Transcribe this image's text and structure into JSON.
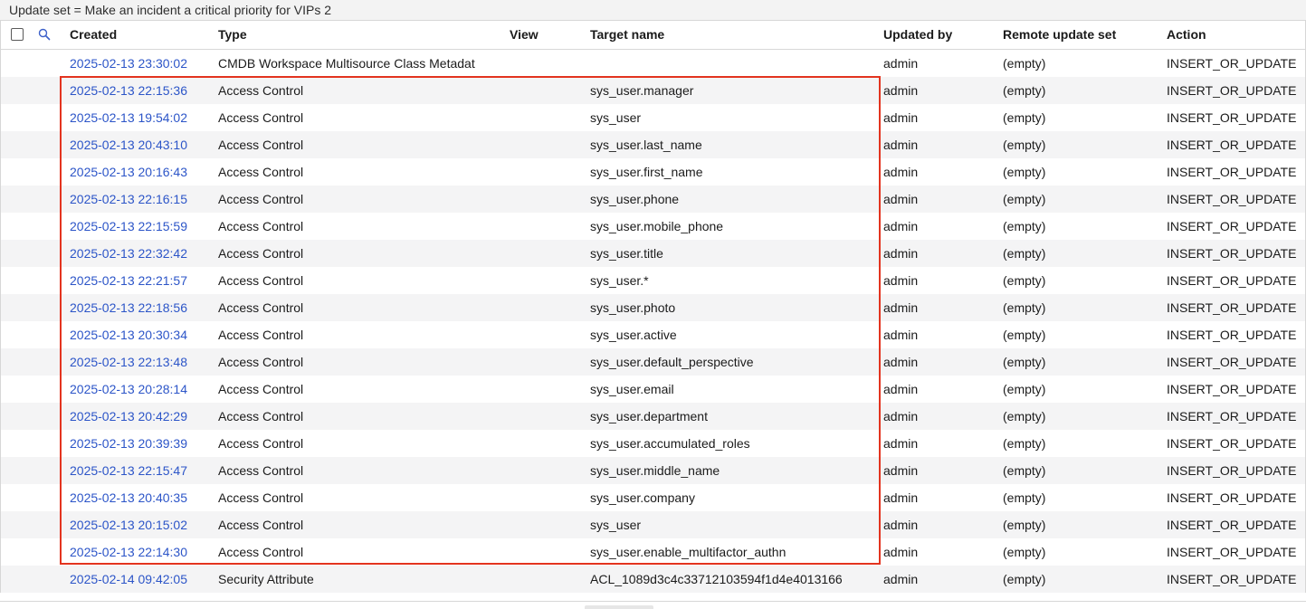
{
  "title_bar": "Update set = Make an incident a critical priority for VIPs 2",
  "columns": {
    "created": "Created",
    "type": "Type",
    "view": "View",
    "target_name": "Target name",
    "updated_by": "Updated by",
    "remote_update_set": "Remote update set",
    "action": "Action"
  },
  "icons": {
    "select_all": "checkbox-icon",
    "search": "search-icon"
  },
  "colors": {
    "link": "#2c55c8",
    "highlight_border": "#e3341f",
    "row_alt": "#f4f4f5"
  },
  "rows": [
    {
      "created": "2025-02-13 23:30:02",
      "type": "CMDB Workspace Multisource Class Metadat",
      "view": "",
      "target": "",
      "updated_by": "admin",
      "remote": "(empty)",
      "action": "INSERT_OR_UPDATE"
    },
    {
      "created": "2025-02-13 22:15:36",
      "type": "Access Control",
      "view": "",
      "target": "sys_user.manager",
      "updated_by": "admin",
      "remote": "(empty)",
      "action": "INSERT_OR_UPDATE"
    },
    {
      "created": "2025-02-13 19:54:02",
      "type": "Access Control",
      "view": "",
      "target": "sys_user",
      "updated_by": "admin",
      "remote": "(empty)",
      "action": "INSERT_OR_UPDATE"
    },
    {
      "created": "2025-02-13 20:43:10",
      "type": "Access Control",
      "view": "",
      "target": "sys_user.last_name",
      "updated_by": "admin",
      "remote": "(empty)",
      "action": "INSERT_OR_UPDATE"
    },
    {
      "created": "2025-02-13 20:16:43",
      "type": "Access Control",
      "view": "",
      "target": "sys_user.first_name",
      "updated_by": "admin",
      "remote": "(empty)",
      "action": "INSERT_OR_UPDATE"
    },
    {
      "created": "2025-02-13 22:16:15",
      "type": "Access Control",
      "view": "",
      "target": "sys_user.phone",
      "updated_by": "admin",
      "remote": "(empty)",
      "action": "INSERT_OR_UPDATE"
    },
    {
      "created": "2025-02-13 22:15:59",
      "type": "Access Control",
      "view": "",
      "target": "sys_user.mobile_phone",
      "updated_by": "admin",
      "remote": "(empty)",
      "action": "INSERT_OR_UPDATE"
    },
    {
      "created": "2025-02-13 22:32:42",
      "type": "Access Control",
      "view": "",
      "target": "sys_user.title",
      "updated_by": "admin",
      "remote": "(empty)",
      "action": "INSERT_OR_UPDATE"
    },
    {
      "created": "2025-02-13 22:21:57",
      "type": "Access Control",
      "view": "",
      "target": "sys_user.*",
      "updated_by": "admin",
      "remote": "(empty)",
      "action": "INSERT_OR_UPDATE"
    },
    {
      "created": "2025-02-13 22:18:56",
      "type": "Access Control",
      "view": "",
      "target": "sys_user.photo",
      "updated_by": "admin",
      "remote": "(empty)",
      "action": "INSERT_OR_UPDATE"
    },
    {
      "created": "2025-02-13 20:30:34",
      "type": "Access Control",
      "view": "",
      "target": "sys_user.active",
      "updated_by": "admin",
      "remote": "(empty)",
      "action": "INSERT_OR_UPDATE"
    },
    {
      "created": "2025-02-13 22:13:48",
      "type": "Access Control",
      "view": "",
      "target": "sys_user.default_perspective",
      "updated_by": "admin",
      "remote": "(empty)",
      "action": "INSERT_OR_UPDATE"
    },
    {
      "created": "2025-02-13 20:28:14",
      "type": "Access Control",
      "view": "",
      "target": "sys_user.email",
      "updated_by": "admin",
      "remote": "(empty)",
      "action": "INSERT_OR_UPDATE"
    },
    {
      "created": "2025-02-13 20:42:29",
      "type": "Access Control",
      "view": "",
      "target": "sys_user.department",
      "updated_by": "admin",
      "remote": "(empty)",
      "action": "INSERT_OR_UPDATE"
    },
    {
      "created": "2025-02-13 20:39:39",
      "type": "Access Control",
      "view": "",
      "target": "sys_user.accumulated_roles",
      "updated_by": "admin",
      "remote": "(empty)",
      "action": "INSERT_OR_UPDATE"
    },
    {
      "created": "2025-02-13 22:15:47",
      "type": "Access Control",
      "view": "",
      "target": "sys_user.middle_name",
      "updated_by": "admin",
      "remote": "(empty)",
      "action": "INSERT_OR_UPDATE"
    },
    {
      "created": "2025-02-13 20:40:35",
      "type": "Access Control",
      "view": "",
      "target": "sys_user.company",
      "updated_by": "admin",
      "remote": "(empty)",
      "action": "INSERT_OR_UPDATE"
    },
    {
      "created": "2025-02-13 20:15:02",
      "type": "Access Control",
      "view": "",
      "target": "sys_user",
      "updated_by": "admin",
      "remote": "(empty)",
      "action": "INSERT_OR_UPDATE"
    },
    {
      "created": "2025-02-13 22:14:30",
      "type": "Access Control",
      "view": "",
      "target": "sys_user.enable_multifactor_authn",
      "updated_by": "admin",
      "remote": "(empty)",
      "action": "INSERT_OR_UPDATE"
    },
    {
      "created": "2025-02-14 09:42:05",
      "type": "Security Attribute",
      "view": "",
      "target": "ACL_1089d3c4c33712103594f1d4e4013166",
      "updated_by": "admin",
      "remote": "(empty)",
      "action": "INSERT_OR_UPDATE"
    }
  ]
}
